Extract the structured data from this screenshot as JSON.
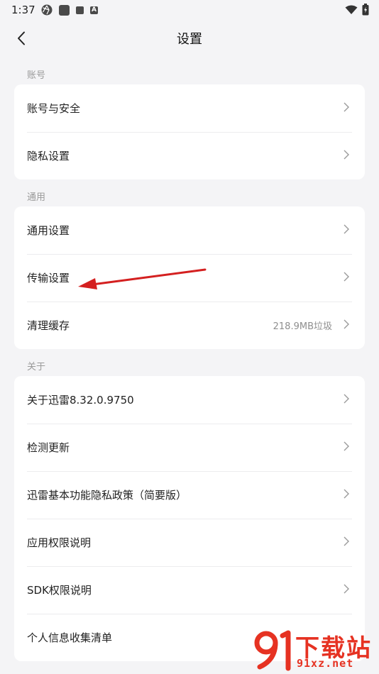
{
  "status_bar": {
    "time": "1:37",
    "notify_letter": "A"
  },
  "header": {
    "title": "设置"
  },
  "sections": [
    {
      "label": "账号",
      "items": [
        {
          "label": "账号与安全",
          "value": ""
        },
        {
          "label": "隐私设置",
          "value": ""
        }
      ]
    },
    {
      "label": "通用",
      "items": [
        {
          "label": "通用设置",
          "value": ""
        },
        {
          "label": "传输设置",
          "value": ""
        },
        {
          "label": "清理缓存",
          "value": "218.9MB垃圾"
        }
      ]
    },
    {
      "label": "关于",
      "items": [
        {
          "label": "关于迅雷8.32.0.9750",
          "value": ""
        },
        {
          "label": "检测更新",
          "value": ""
        },
        {
          "label": "迅雷基本功能隐私政策（简要版）",
          "value": ""
        },
        {
          "label": "应用权限说明",
          "value": ""
        },
        {
          "label": "SDK权限说明",
          "value": ""
        },
        {
          "label": "个人信息收集清单",
          "value": ""
        }
      ]
    }
  ],
  "watermark": {
    "top": "下载站",
    "bottom": "91xz.net"
  },
  "colors": {
    "accent": "#e63222",
    "background": "#f4f4f6",
    "card": "#ffffff"
  }
}
